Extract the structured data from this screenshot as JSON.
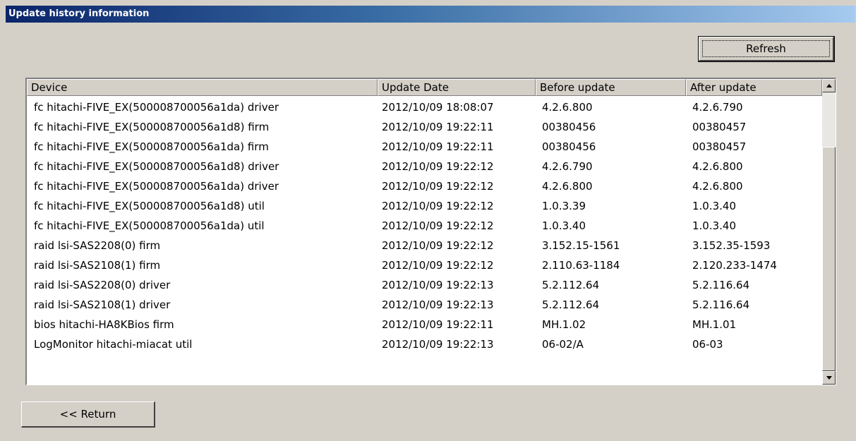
{
  "window": {
    "title": "Update history information"
  },
  "buttons": {
    "refresh": "Refresh",
    "return": "<< Return"
  },
  "table": {
    "columns": [
      "Device",
      "Update Date",
      "Before update",
      "After update"
    ],
    "rows": [
      [
        "fc hitachi-FIVE_EX(500008700056a1da) driver",
        "2012/10/09 18:08:07",
        "4.2.6.800",
        "4.2.6.790"
      ],
      [
        "fc hitachi-FIVE_EX(500008700056a1d8) firm",
        "2012/10/09 19:22:11",
        "00380456",
        "00380457"
      ],
      [
        "fc hitachi-FIVE_EX(500008700056a1da) firm",
        "2012/10/09 19:22:11",
        "00380456",
        "00380457"
      ],
      [
        "fc hitachi-FIVE_EX(500008700056a1d8) driver",
        "2012/10/09 19:22:12",
        "4.2.6.790",
        "4.2.6.800"
      ],
      [
        "fc hitachi-FIVE_EX(500008700056a1da) driver",
        "2012/10/09 19:22:12",
        "4.2.6.800",
        "4.2.6.800"
      ],
      [
        "fc hitachi-FIVE_EX(500008700056a1d8) util",
        "2012/10/09 19:22:12",
        "1.0.3.39",
        "1.0.3.40"
      ],
      [
        "fc hitachi-FIVE_EX(500008700056a1da) util",
        "2012/10/09 19:22:12",
        "1.0.3.40",
        "1.0.3.40"
      ],
      [
        "raid lsi-SAS2208(0) firm",
        "2012/10/09 19:22:12",
        "3.152.15-1561",
        "3.152.35-1593"
      ],
      [
        "raid lsi-SAS2108(1) firm",
        "2012/10/09 19:22:12",
        "2.110.63-1184",
        "2.120.233-1474"
      ],
      [
        "raid lsi-SAS2208(0) driver",
        "2012/10/09 19:22:13",
        "5.2.112.64",
        "5.2.116.64"
      ],
      [
        "raid lsi-SAS2108(1) driver",
        "2012/10/09 19:22:13",
        "5.2.112.64",
        "5.2.116.64"
      ],
      [
        "bios hitachi-HA8KBios firm",
        "2012/10/09 19:22:11",
        "MH.1.02",
        "MH.1.01"
      ],
      [
        "LogMonitor hitachi-miacat util",
        "2012/10/09 19:22:13",
        "06-02/A",
        "06-03"
      ]
    ]
  }
}
